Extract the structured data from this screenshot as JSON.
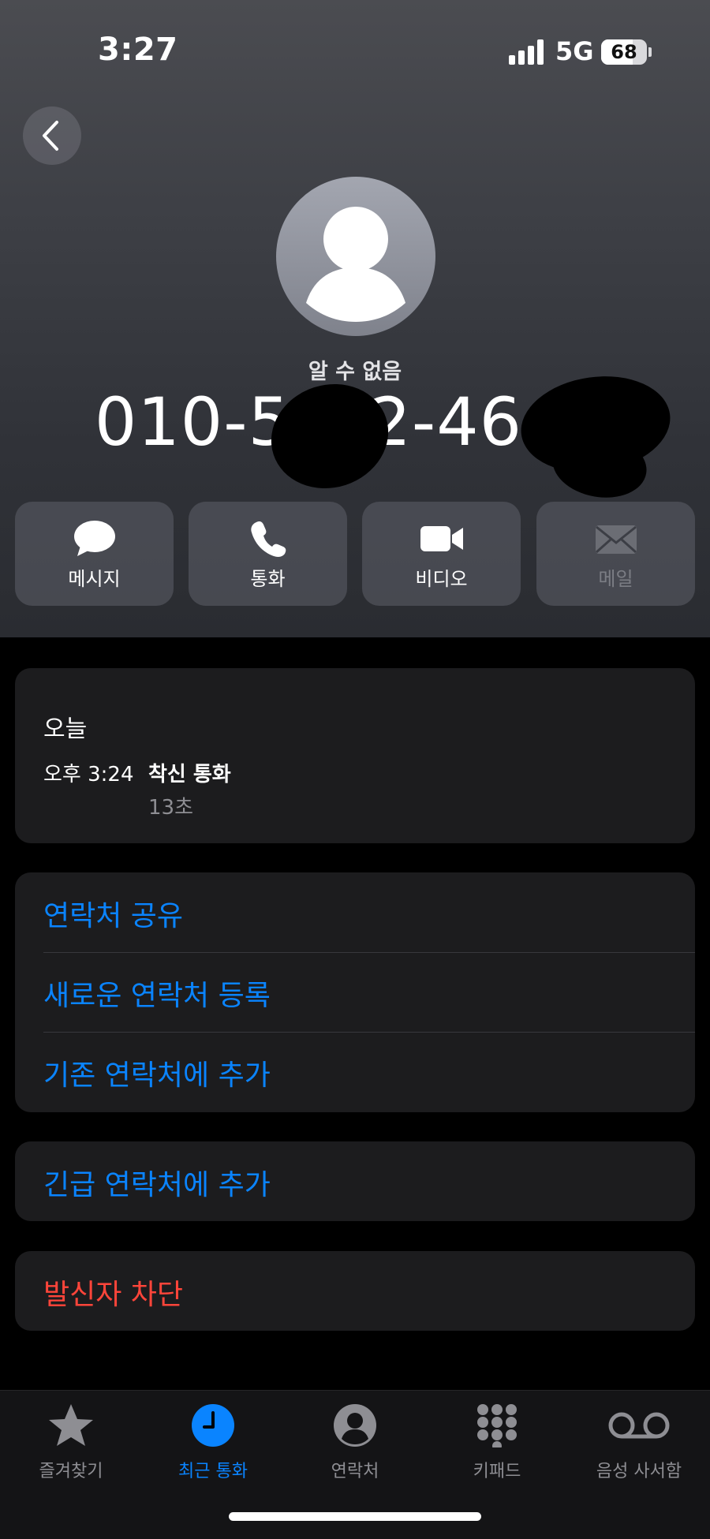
{
  "status_bar": {
    "time": "3:27",
    "network": "5G",
    "battery": "68"
  },
  "caller": {
    "label": "알 수 없음",
    "number_visible": "010-57 2-46",
    "number_part1": "010-57",
    "number_part2": "2-46"
  },
  "actions": [
    {
      "label": "메시지",
      "icon": "message-bubble-icon"
    },
    {
      "label": "통화",
      "icon": "phone-icon"
    },
    {
      "label": "비디오",
      "icon": "video-camera-icon"
    },
    {
      "label": "메일",
      "icon": "envelope-icon",
      "disabled": true
    }
  ],
  "history": {
    "day": "오늘",
    "time": "오후 3:24",
    "type": "착신 통화",
    "duration": "13초"
  },
  "options": {
    "share_contact": "연락처 공유",
    "create_new_contact": "새로운 연락처 등록",
    "add_to_existing": "기존 연락처에 추가",
    "add_emergency": "긴급 연락처에 추가",
    "block_caller": "발신자 차단"
  },
  "tabs": [
    {
      "label": "즐겨찾기",
      "icon": "star-icon"
    },
    {
      "label": "최근 통화",
      "icon": "clock-icon",
      "active": true
    },
    {
      "label": "연락처",
      "icon": "person-circle-icon"
    },
    {
      "label": "키패드",
      "icon": "keypad-icon"
    },
    {
      "label": "음성 사서함",
      "icon": "voicemail-icon"
    }
  ],
  "colors": {
    "accent": "#0a84ff",
    "destructive": "#ff453a",
    "card": "#1c1c1e"
  }
}
